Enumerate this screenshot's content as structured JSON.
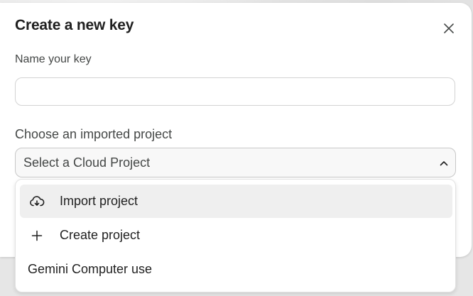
{
  "dialog": {
    "title": "Create a new key",
    "name_label": "Name your key",
    "name_value": "",
    "project_label": "Choose an imported project",
    "select_placeholder": "Select a Cloud Project"
  },
  "menu": {
    "items": [
      {
        "label": "Import project",
        "icon": "cloud-download-icon"
      },
      {
        "label": "Create project",
        "icon": "plus-icon"
      },
      {
        "label": "Gemini Computer use",
        "icon": ""
      }
    ]
  }
}
